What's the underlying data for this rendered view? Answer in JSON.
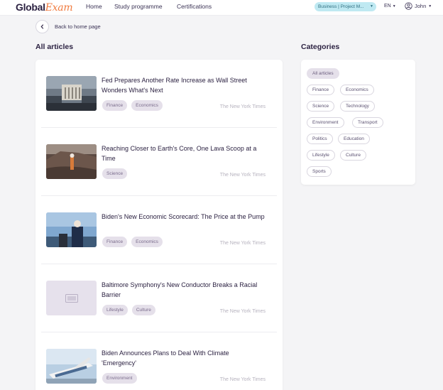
{
  "header": {
    "logo": {
      "part1": "Global",
      "part2": "Exam"
    },
    "nav": [
      {
        "label": "Home"
      },
      {
        "label": "Study programme"
      },
      {
        "label": "Certifications"
      }
    ],
    "business_badge": "Business | Project M...",
    "language": "EN",
    "user_name": "John"
  },
  "back_link": "Back to home page",
  "articles_heading": "All articles",
  "categories_heading": "Categories",
  "articles": [
    {
      "title": "Fed Prepares Another Rate Increase as Wall Street Wonders What's Next",
      "tags": [
        "Finance",
        "Economics"
      ],
      "source": "The New York Times"
    },
    {
      "title": "Reaching Closer to Earth's Core, One Lava Scoop at a Time",
      "tags": [
        "Science"
      ],
      "source": "The New York Times"
    },
    {
      "title": "Biden's New Economic Scorecard: The Price at the Pump",
      "tags": [
        "Finance",
        "Economics"
      ],
      "source": "The New York Times"
    },
    {
      "title": "Baltimore Symphony's New Conductor Breaks a Racial Barrier",
      "tags": [
        "Lifestyle",
        "Culture"
      ],
      "source": "The New York Times"
    },
    {
      "title": "Biden Announces Plans to Deal With Climate 'Emergency'",
      "tags": [
        "Environment"
      ],
      "source": "The New York Times"
    }
  ],
  "categories": [
    "All articles",
    "Finance",
    "Economics",
    "Science",
    "Technology",
    "Environment",
    "Transport",
    "Politics",
    "Education",
    "Lifestyle",
    "Culture",
    "Sports"
  ],
  "colors": {
    "accent": "#f07b3f",
    "badge": "#bfe9f2",
    "tag_bg": "#e5e0ea",
    "text": "#2c2242"
  }
}
